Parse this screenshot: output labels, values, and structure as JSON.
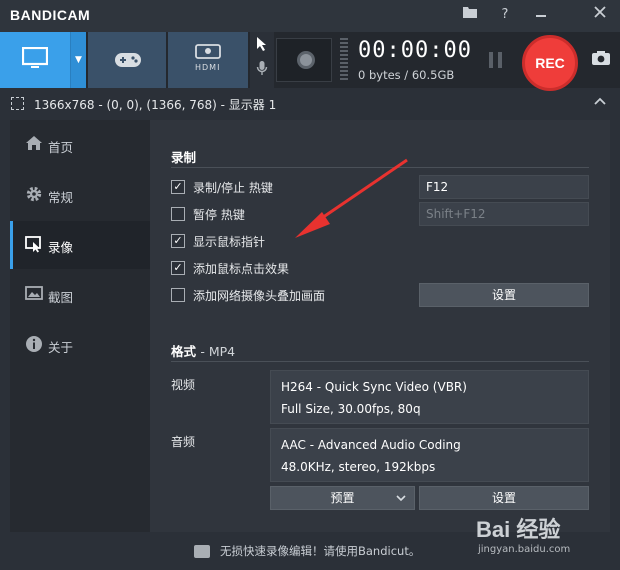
{
  "app": {
    "brand": "BANDICAM"
  },
  "titlebar": {
    "icons": [
      "folder-icon",
      "help-icon",
      "minimize-icon",
      "close-icon"
    ],
    "help_glyph": "?"
  },
  "toolbar": {
    "modes": [
      "screen-mode",
      "game-mode",
      "device-mode"
    ],
    "device_label": "HDMI",
    "timer": "00:00:00",
    "size": "0 bytes / 60.5GB",
    "rec_label": "REC"
  },
  "region": {
    "text": "1366x768 - (0, 0), (1366, 768) - 显示器 1"
  },
  "sidebar": {
    "items": [
      {
        "label": "首页",
        "icon": "home-icon"
      },
      {
        "label": "常规",
        "icon": "gear-icon"
      },
      {
        "label": "录像",
        "icon": "video-icon",
        "active": true
      },
      {
        "label": "截图",
        "icon": "image-icon"
      },
      {
        "label": "关于",
        "icon": "info-icon"
      }
    ]
  },
  "record": {
    "title": "录制",
    "options": [
      {
        "label": "录制/停止 热键",
        "checked": true
      },
      {
        "label": "暂停 热键",
        "checked": false
      },
      {
        "label": "显示鼠标指针",
        "checked": true
      },
      {
        "label": "添加鼠标点击效果",
        "checked": true
      },
      {
        "label": "添加网络摄像头叠加画面",
        "checked": false
      }
    ],
    "hotkey_record": "F12",
    "hotkey_pause": "Shift+F12",
    "webcam_settings": "设置"
  },
  "format": {
    "title": "格式",
    "container": "- MP4",
    "video_label": "视频",
    "video_codec": "H264 - Quick Sync Video (VBR)",
    "video_detail": "Full Size, 30.00fps, 80q",
    "audio_label": "音频",
    "audio_codec": "AAC - Advanced Audio Coding",
    "audio_detail": "48.0KHz, stereo, 192kbps",
    "preset_label": "预置",
    "settings_label": "设置"
  },
  "footer": {
    "text": "无损快速录像编辑！请使用Bandicut。"
  },
  "watermark": {
    "main": "Bai 经验",
    "sub": "jingyan.baidu.com"
  },
  "colors": {
    "accent": "#3aa0ea",
    "rec": "#ef3d3a",
    "arrow": "#e8322f"
  }
}
